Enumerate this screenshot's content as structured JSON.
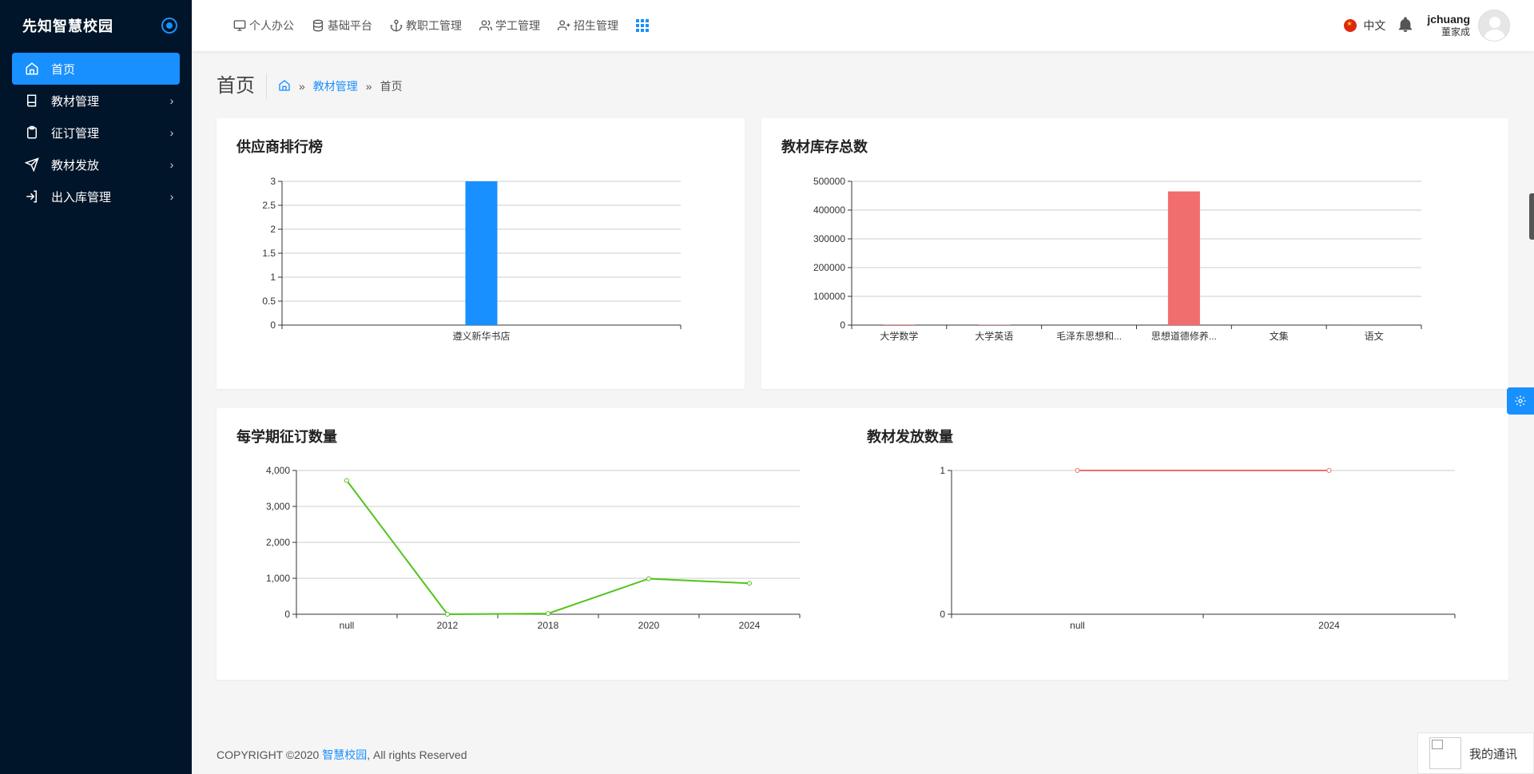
{
  "brand": {
    "title": "先知智慧校园"
  },
  "sidebar": {
    "items": [
      {
        "label": "首页",
        "icon": "home-icon",
        "active": true
      },
      {
        "label": "教材管理",
        "icon": "book-icon"
      },
      {
        "label": "征订管理",
        "icon": "clipboard-icon"
      },
      {
        "label": "教材发放",
        "icon": "send-icon"
      },
      {
        "label": "出入库管理",
        "icon": "login-icon"
      }
    ]
  },
  "topnav": {
    "items": [
      {
        "label": "个人办公",
        "icon": "monitor-icon"
      },
      {
        "label": "基础平台",
        "icon": "database-icon"
      },
      {
        "label": "教职工管理",
        "icon": "anchor-icon"
      },
      {
        "label": "学工管理",
        "icon": "users-icon"
      },
      {
        "label": "招生管理",
        "icon": "user-plus-icon"
      }
    ]
  },
  "header": {
    "language": "中文",
    "user_name": "jchuang",
    "user_display": "董家成"
  },
  "page": {
    "title": "首页",
    "breadcrumb": [
      "教材管理",
      "首页"
    ]
  },
  "cards": {
    "supplier": {
      "title": "供应商排行榜"
    },
    "stock": {
      "title": "教材库存总数"
    },
    "orders": {
      "title": "每学期征订数量"
    },
    "distribution": {
      "title": "教材发放数量"
    }
  },
  "chart_data": [
    {
      "type": "bar",
      "title": "供应商排行榜",
      "categories": [
        "遵义新华书店"
      ],
      "values": [
        3
      ],
      "ylim": [
        0,
        3
      ],
      "yticks": [
        "0",
        "0.5",
        "1",
        "1.5",
        "2",
        "2.5",
        "3"
      ],
      "color": "#1890ff",
      "grid": true
    },
    {
      "type": "bar",
      "title": "教材库存总数",
      "categories": [
        "大学数学",
        "大学英语",
        "毛泽东思想和...",
        "思想道德修养...",
        "文集",
        "语文"
      ],
      "values": [
        2000,
        1000,
        0,
        465000,
        0,
        200
      ],
      "ylim": [
        0,
        500000
      ],
      "yticks": [
        "0",
        "100000",
        "200000",
        "300000",
        "400000",
        "500000"
      ],
      "color": "#f26d6d",
      "grid": true
    },
    {
      "type": "line",
      "title": "每学期征订数量",
      "categories": [
        "null",
        "2012",
        "2018",
        "2020",
        "2024"
      ],
      "values": [
        3720,
        0,
        20,
        990,
        860
      ],
      "ylim": [
        0,
        4000
      ],
      "yticks": [
        "0",
        "1,000",
        "2,000",
        "3,000",
        "4,000"
      ],
      "color": "#52c41a",
      "grid": true
    },
    {
      "type": "line",
      "title": "教材发放数量",
      "categories": [
        "null",
        "2024"
      ],
      "values": [
        1,
        1
      ],
      "ylim": [
        0,
        1
      ],
      "yticks": [
        "0",
        "1"
      ],
      "color": "#f26d6d",
      "grid": true
    }
  ],
  "footer": {
    "prefix": "COPYRIGHT ©2020 ",
    "brand": "智慧校园",
    "suffix": ", All rights Reserved"
  },
  "comm": {
    "label": "我的通讯"
  }
}
